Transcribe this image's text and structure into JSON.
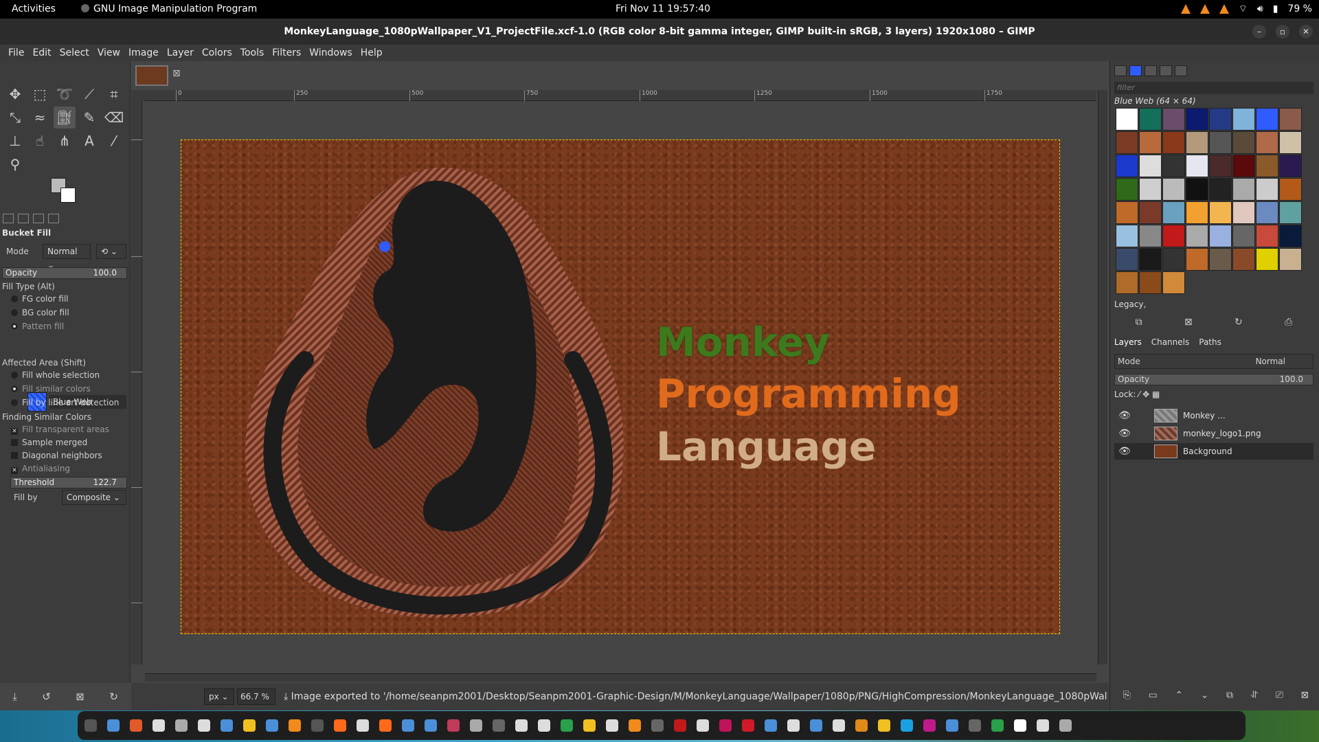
{
  "topbar": {
    "activities": "Activities",
    "app_name": "GNU Image Manipulation Program",
    "clock": "Fri Nov 11  19:57:40",
    "battery": "79 %"
  },
  "window": {
    "title": "MonkeyLanguage_1080pWallpaper_V1_ProjectFile.xcf-1.0 (RGB color 8-bit gamma integer, GIMP built-in sRGB, 3 layers) 1920x1080 – GIMP"
  },
  "menu": [
    "File",
    "Edit",
    "Select",
    "View",
    "Image",
    "Layer",
    "Colors",
    "Tools",
    "Filters",
    "Windows",
    "Help"
  ],
  "tool_options": {
    "title": "Bucket Fill",
    "mode_label": "Mode",
    "mode_value": "Normal",
    "opacity_label": "Opacity",
    "opacity_value": "100.0",
    "fill_type_label": "Fill Type  (Alt)",
    "fill_types": [
      "FG color fill",
      "BG color fill",
      "Pattern fill"
    ],
    "pattern_name": "Blue Web",
    "affected_label": "Affected Area  (Shift)",
    "affected": [
      "Fill whole selection",
      "Fill similar colors",
      "Fill by line art detection"
    ],
    "finding_label": "Finding Similar Colors",
    "finding": [
      "Fill transparent areas",
      "Sample merged",
      "Diagonal neighbors",
      "Antialiasing"
    ],
    "threshold_label": "Threshold",
    "threshold_value": "122.7",
    "fill_by_label": "Fill by",
    "fill_by_value": "Composite"
  },
  "canvas": {
    "ruler_ticks": [
      "0",
      "250",
      "500",
      "750",
      "1000",
      "1250",
      "1500",
      "1750"
    ],
    "text_lines": [
      "Monkey",
      "Programming",
      "Language"
    ]
  },
  "status": {
    "unit": "px",
    "zoom": "66.7 %",
    "message": "Image exported to '/home/seanpm2001/Desktop/Seanpm2001-Graphic-Design/M/MonkeyLanguage/Wallpaper/1080p/PNG/HighCompression/MonkeyLanguage_1080pWallpa..."
  },
  "patterns": {
    "filter_placeholder": "filter",
    "selected_label": "Blue Web (64 × 64)",
    "tag_filter": "Legacy,"
  },
  "layers": {
    "tabs": [
      "Layers",
      "Channels",
      "Paths"
    ],
    "mode_label": "Mode",
    "mode_value": "Normal",
    "opacity_label": "Opacity",
    "opacity_value": "100.0",
    "lock_label": "Lock:",
    "items": [
      "Monkey ...",
      "monkey_logo1.png",
      "Background"
    ]
  },
  "colors": {
    "accent": "#2f5bff",
    "canvas_bg": "#7a3a1d",
    "text_green": "#3e7a1d",
    "text_orange": "#e16b1c",
    "text_tan": "#d0ad86"
  }
}
